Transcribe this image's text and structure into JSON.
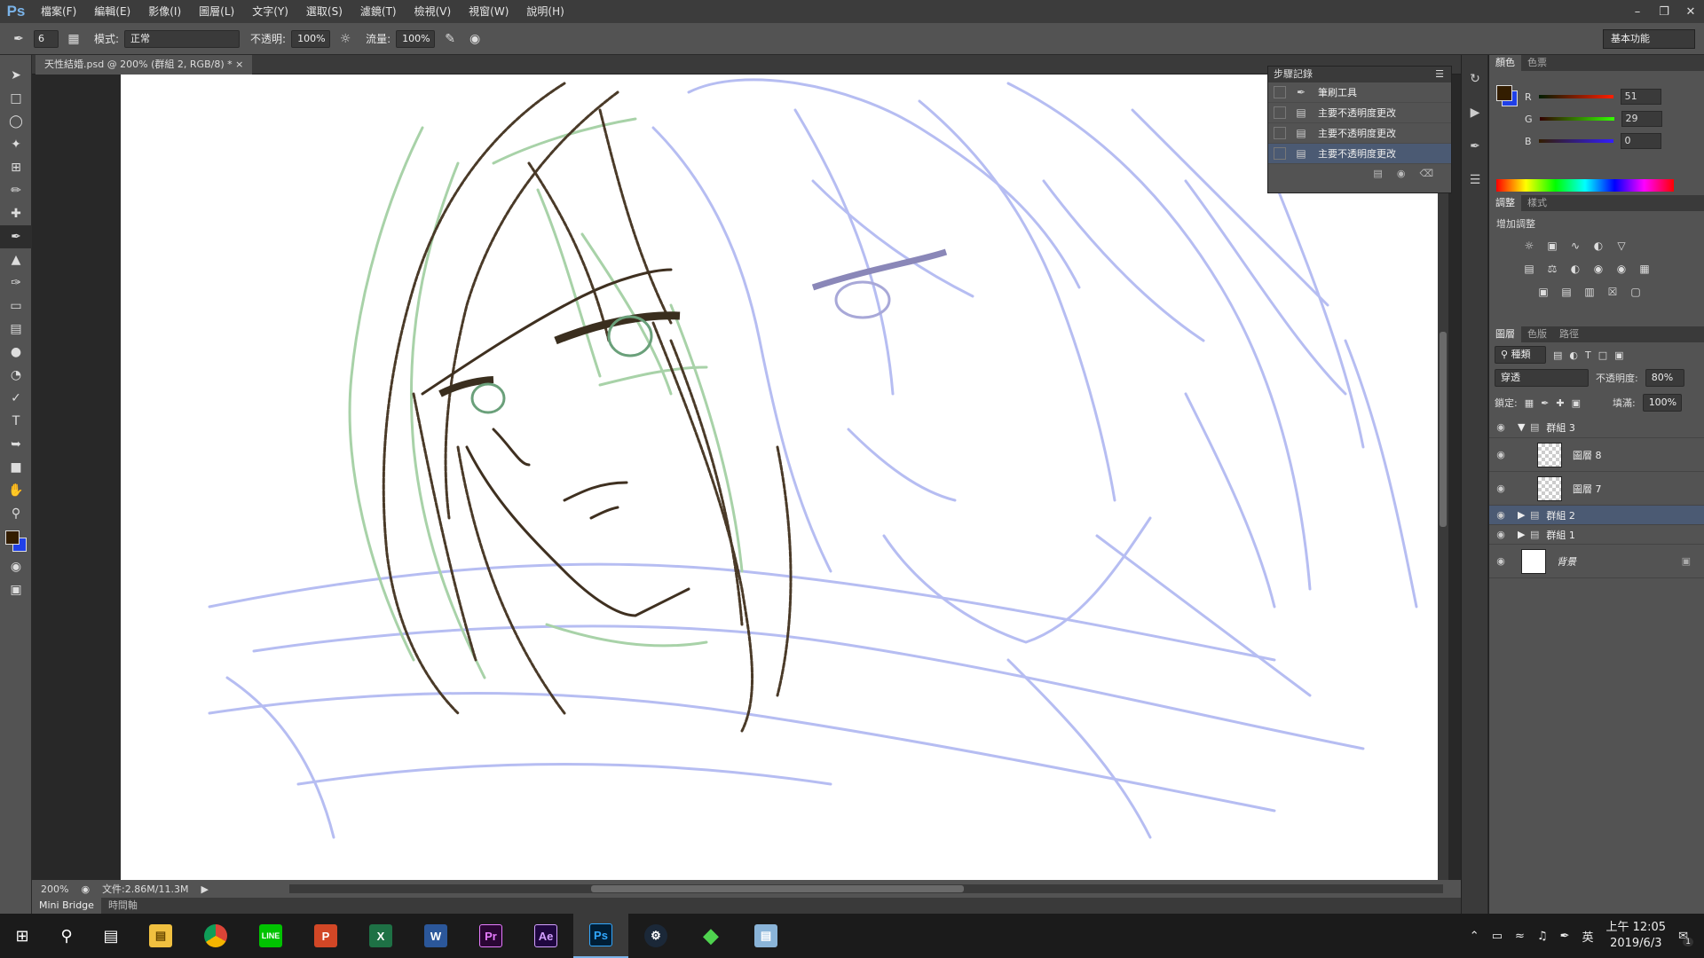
{
  "app": {
    "logo": "Ps"
  },
  "menu": [
    "檔案(F)",
    "編輯(E)",
    "影像(I)",
    "圖層(L)",
    "文字(Y)",
    "選取(S)",
    "濾鏡(T)",
    "檢視(V)",
    "視窗(W)",
    "說明(H)"
  ],
  "options": {
    "brush_size": "6",
    "mode_label": "模式:",
    "mode_value": "正常",
    "opacity_label": "不透明:",
    "opacity_value": "100%",
    "flow_label": "流量:",
    "flow_value": "100%",
    "workspace": "基本功能"
  },
  "document": {
    "tab_title": "天性結婚.psd @ 200% (群組 2, RGB/8) *",
    "zoom": "200%",
    "doc_size": "文件:2.86M/11.3M"
  },
  "bottom_tabs": [
    "Mini Bridge",
    "時間軸"
  ],
  "history": {
    "title": "步驟記錄",
    "items": [
      "筆刷工具",
      "主要不透明度更改",
      "主要不透明度更改",
      "主要不透明度更改"
    ]
  },
  "color_panel": {
    "tabs": [
      "顏色",
      "色票"
    ],
    "r": "51",
    "g": "29",
    "b": "0",
    "fg": "#331d00",
    "bg": "#2040e8"
  },
  "adjust_panel": {
    "tabs": [
      "調整",
      "樣式"
    ],
    "title": "增加調整"
  },
  "layers_panel": {
    "tabs": [
      "圖層",
      "色版",
      "路徑"
    ],
    "filter_label": "種類",
    "blend_mode": "穿透",
    "opacity_label": "不透明度:",
    "opacity_value": "80%",
    "lock_label": "鎖定:",
    "fill_label": "填滿:",
    "fill_value": "100%",
    "layers": [
      "群組 3",
      "圖層 8",
      "圖層 7",
      "群組 2",
      "群組 1",
      "背景"
    ]
  },
  "taskbar": {
    "apps": [
      "P",
      "X",
      "W",
      "Pr",
      "Ae",
      "Ps"
    ],
    "ime": "英",
    "time": "上午 12:05",
    "date": "2019/6/3",
    "notif_count": "1"
  }
}
